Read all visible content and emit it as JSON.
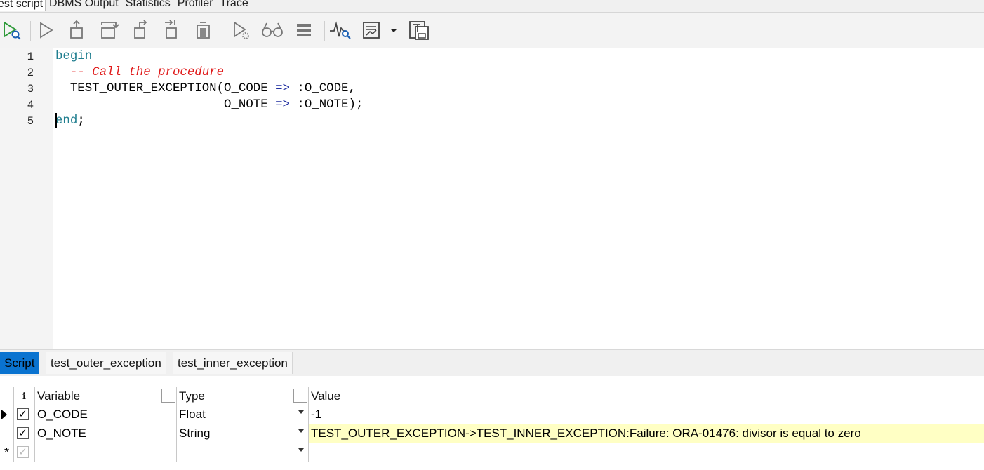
{
  "top_tabs": [
    {
      "label": "est script",
      "active": true
    },
    {
      "label": "DBMS Output",
      "active": false
    },
    {
      "label": "Statistics",
      "active": false
    },
    {
      "label": "Profiler",
      "active": false
    },
    {
      "label": "Trace",
      "active": false
    }
  ],
  "toolbar": {
    "buttons": [
      "execute-icon",
      "run-icon",
      "step-into-icon",
      "step-over-icon",
      "step-out-icon",
      "run-to-exception-icon",
      "run-to-cursor-icon",
      "debug-run-icon",
      "watch-icon",
      "call-stack-icon",
      "profiler-icon",
      "output-icon",
      "dropdown-icon",
      "save-template-icon"
    ]
  },
  "editor": {
    "line_numbers": [
      "1",
      "2",
      "3",
      "4",
      "5"
    ],
    "lines": {
      "l1_kw": "begin",
      "l2_comment": "  -- Call the procedure",
      "l3_proc": "  TEST_OUTER_EXCEPTION(O_CODE ",
      "l3_op": "=>",
      "l3_rest": " :O_CODE,",
      "l4_pad": "                       O_NOTE ",
      "l4_op": "=>",
      "l4_rest": " :O_NOTE);",
      "l5_kw": "end",
      "l5_rest": ";"
    }
  },
  "bottom_tabs": [
    {
      "label": "Script",
      "active": true
    },
    {
      "label": "test_outer_exception",
      "active": false
    },
    {
      "label": "test_inner_exception",
      "active": false
    }
  ],
  "grid": {
    "headers": {
      "info": "ℹ",
      "variable": "Variable",
      "type": "Type",
      "value": "Value"
    },
    "rows": [
      {
        "checked": true,
        "variable": "O_CODE",
        "type": "Float",
        "value": "-1",
        "highlight": false
      },
      {
        "checked": true,
        "variable": "O_NOTE",
        "type": "String",
        "value": "TEST_OUTER_EXCEPTION->TEST_INNER_EXCEPTION:Failure: ORA-01476: divisor is equal to zero",
        "highlight": true
      }
    ],
    "new_row_marker": "*",
    "colors": {
      "highlight": "#ffffc4",
      "active_tab": "#0a73d0"
    }
  }
}
